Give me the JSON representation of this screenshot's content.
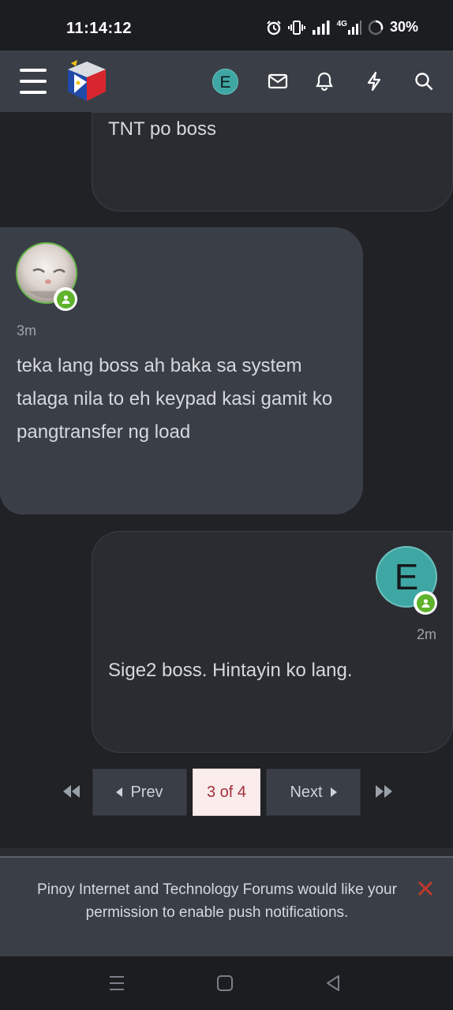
{
  "status_bar": {
    "time": "11:14:12",
    "network": "4G",
    "battery": "30%"
  },
  "header": {
    "avatar_letter": "E",
    "icons": [
      "menu-icon",
      "forum-logo",
      "envelope-icon",
      "bell-icon",
      "bolt-icon",
      "search-icon"
    ]
  },
  "messages": [
    {
      "text": "TNT po boss"
    },
    {
      "time": "3m",
      "text": "teka lang boss ah baka sa system talaga nila to eh keypad kasi gamit ko pangtransfer ng load"
    },
    {
      "avatar_letter": "E",
      "time": "2m",
      "text": "Sige2 boss. Hintayin ko lang."
    }
  ],
  "pagination": {
    "prev": "Prev",
    "current": "3 of 4",
    "next": "Next"
  },
  "push_prompt": {
    "text": "Pinoy Internet and Technology Forums would like your permission to enable push notifications."
  },
  "colors": {
    "accent": "#3fa7a3",
    "online": "#5fb32d",
    "close": "#c0392b",
    "page_current_text": "#a2303a"
  }
}
